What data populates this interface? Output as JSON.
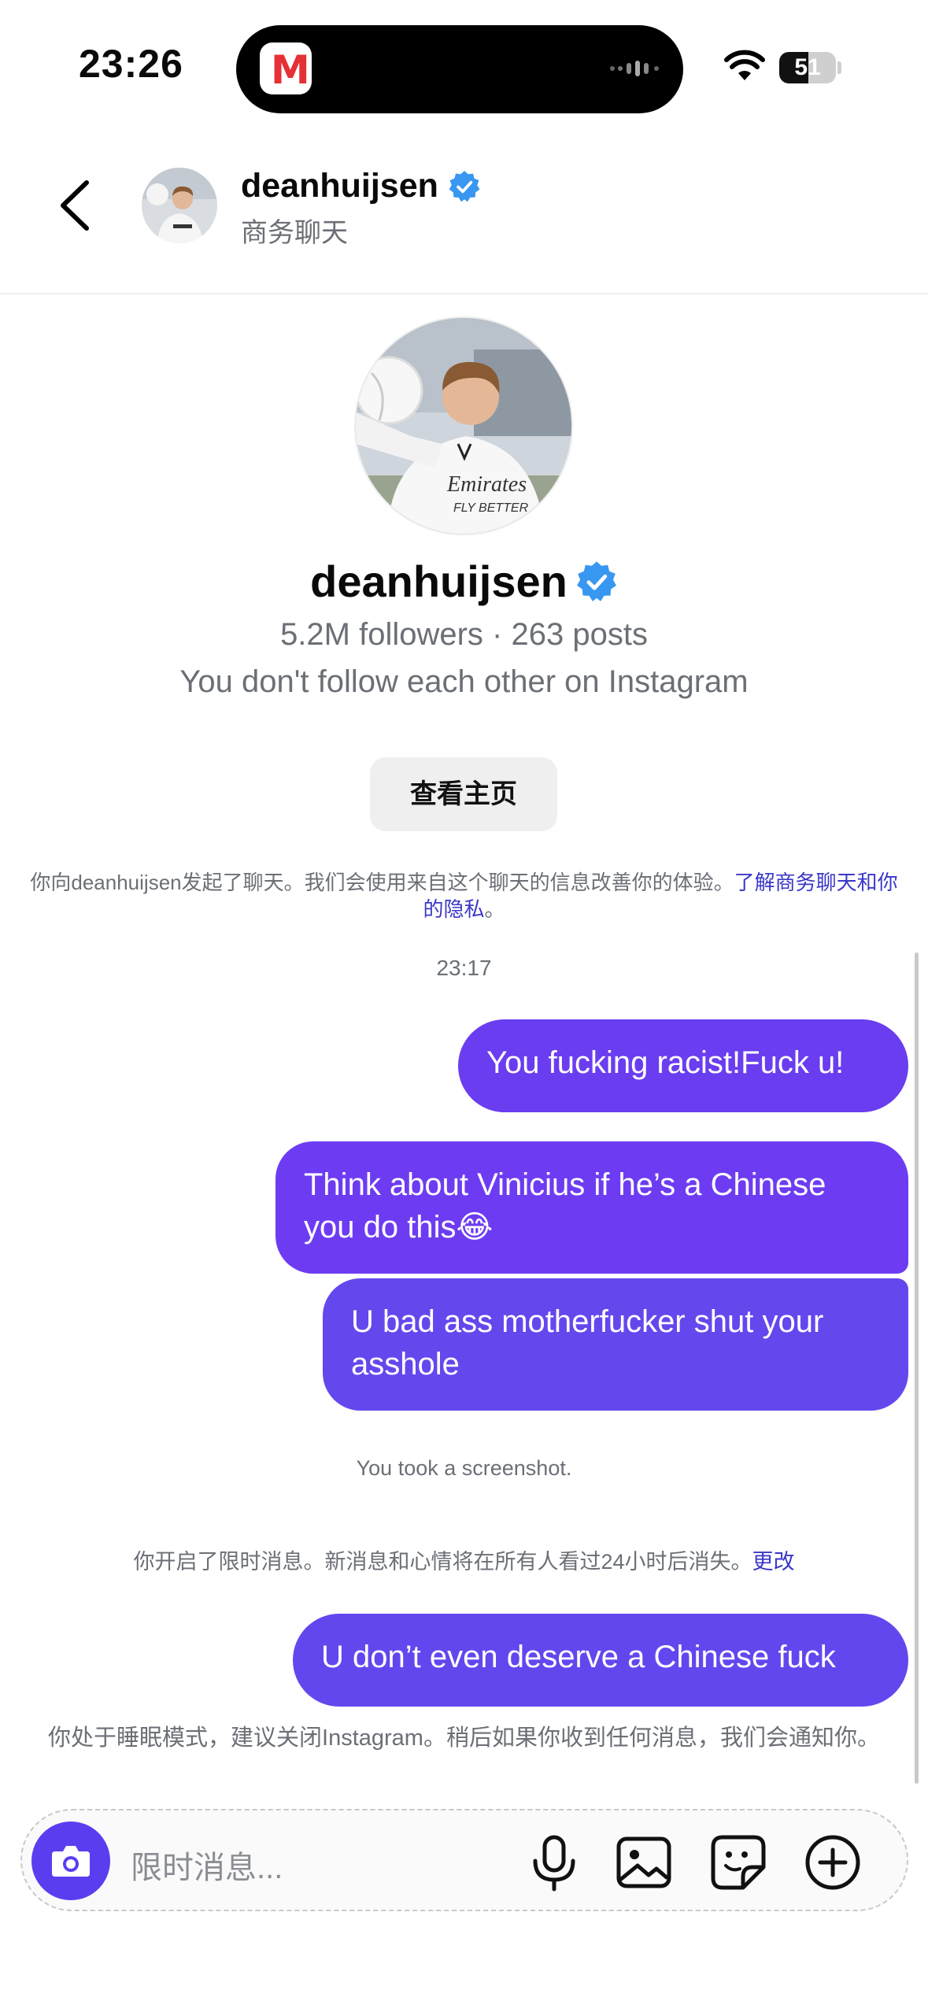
{
  "status_bar": {
    "time": "23:26",
    "battery": "51",
    "battery_level": 0.51
  },
  "header": {
    "username": "deanhuijsen",
    "subtitle": "商务聊天"
  },
  "profile": {
    "username": "deanhuijsen",
    "stats": "5.2M followers · 263 posts",
    "follow_status": "You don't follow each other on Instagram",
    "view_profile_label": "查看主页"
  },
  "chat_info": {
    "text": "你向deanhuijsen发起了聊天。我们会使用来自这个聊天的信息改善你的体验。",
    "link": "了解商务聊天和你的隐私",
    "end": "。"
  },
  "timestamp": "23:17",
  "messages": [
    {
      "text": "You fucking racist!Fuck u!"
    },
    {
      "text": "Think about Vinicius if he’s a Chinese you do this😂"
    },
    {
      "text": "U bad ass motherfucker shut your asshole"
    },
    {
      "text": "U don’t even deserve a Chinese fuck"
    }
  ],
  "notices": {
    "screenshot": "You took a screenshot.",
    "vanish": "你开启了限时消息。新消息和心情将在所有人看过24小时后消失。",
    "vanish_link": "更改",
    "sleep": "你处于睡眠模式，建议关闭Instagram。稍后如果你收到任何消息，我们会通知你。"
  },
  "composer": {
    "placeholder": "限时消息..."
  },
  "icons": {
    "back": "chevron-left-icon",
    "verified": "verified-badge-icon",
    "camera": "camera-icon",
    "mic": "microphone-icon",
    "gallery": "image-icon",
    "sticker": "sticker-icon",
    "plus": "plus-circle-icon"
  },
  "colors": {
    "bubble": "#6a3df0",
    "verified": "#3897f0",
    "link": "#3b38c8",
    "camera_button": "#5b3df0"
  }
}
